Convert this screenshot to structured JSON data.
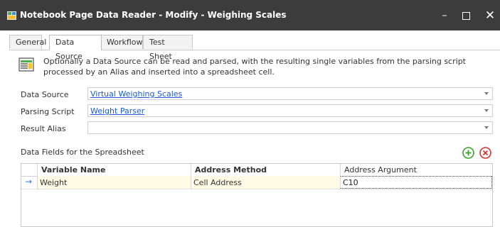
{
  "window": {
    "title": "Notebook Page Data Reader - Modify - Weighing Scales",
    "minimize": "–",
    "close": "✕"
  },
  "tabs": [
    {
      "label": "General",
      "active": false
    },
    {
      "label": "Data Source",
      "active": true
    },
    {
      "label": "Workflow",
      "active": false
    },
    {
      "label": "Test Sheet",
      "active": false
    }
  ],
  "info": {
    "text": "Optionally a Data Source can be read and parsed, with the resulting single variables from the parsing script processed by an Alias and inserted into a spreadsheet cell."
  },
  "form": {
    "data_source": {
      "label": "Data Source",
      "value": "Virtual Weighing Scales"
    },
    "parsing_script": {
      "label": "Parsing Script",
      "value": "Weight Parser"
    },
    "result_alias": {
      "label": "Result Alias",
      "value": ""
    }
  },
  "fields": {
    "section_label": "Data Fields for the Spreadsheet",
    "columns": [
      "Variable Name",
      "Address Method",
      "Address Argument"
    ],
    "rows": [
      {
        "indicator": "→",
        "variable": "Weight",
        "method": "Cell Address",
        "argument": "C10"
      }
    ]
  },
  "colors": {
    "titlebar": "#3c3c3c",
    "link": "#1a5ad6",
    "add": "#3aa32a",
    "delete": "#e0302a",
    "row_highlight": "#fffbe6"
  },
  "icons": [
    "app-icon",
    "info-sheet-icon",
    "add-circle-icon",
    "delete-circle-icon",
    "dropdown-arrow-icon",
    "row-indicator-arrow-icon"
  ]
}
